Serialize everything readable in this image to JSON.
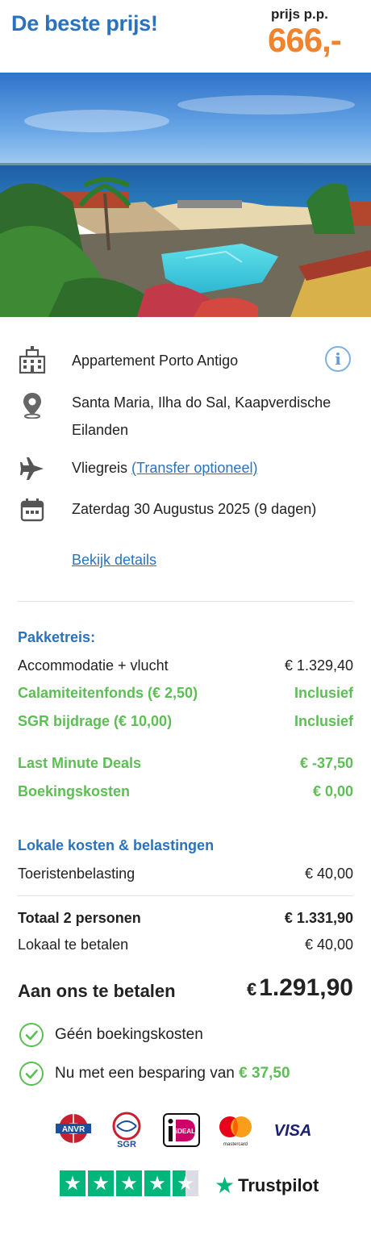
{
  "header": {
    "title": "De beste prijs!",
    "price_label": "prijs p.p.",
    "price": "666,-"
  },
  "hotel": {
    "name": "Appartement Porto Antigo",
    "location_line1": "Santa Maria, Ilha do Sal, Kaapverdische",
    "location_line2": "Eilanden",
    "travel_type": "Vliegreis",
    "transfer_link": "(Transfer optioneel)",
    "date": "Zaterdag 30 Augustus 2025 (9 dagen)",
    "details_link": "Bekijk details",
    "info_icon": "i"
  },
  "costs": {
    "package_heading": "Pakketreis:",
    "rows": [
      {
        "label": "Accommodatie + vlucht",
        "value": "€ 1.329,40"
      },
      {
        "label": "Calamiteitenfonds (€ 2,50)",
        "value": "Inclusief"
      },
      {
        "label": "SGR bijdrage (€ 10,00)",
        "value": "Inclusief"
      },
      {
        "label": "Last Minute Deals",
        "value": "€ -37,50"
      },
      {
        "label": "Boekingskosten",
        "value": "€ 0,00"
      }
    ],
    "local_heading": "Lokale kosten & belastingen",
    "tourist_tax_label": "Toeristenbelasting",
    "tourist_tax_value": "€ 40,00",
    "total_label": "Totaal 2 personen",
    "total_value": "€ 1.331,90",
    "local_pay_label": "Lokaal te betalen",
    "local_pay_value": "€ 40,00",
    "pay_label": "Aan ons te betalen",
    "pay_currency": "€",
    "pay_value": "1.291,90"
  },
  "benefits": {
    "no_booking_costs": "Géén boekingskosten",
    "savings_prefix": "Nu met een besparing van",
    "savings_amount": "€ 37,50"
  },
  "logos": {
    "anvr": "ANVR",
    "sgr": "SGR",
    "ideal": "iDEAL",
    "mastercard": "mastercard",
    "visa": "VISA"
  },
  "trustpilot": {
    "label": "Trustpilot",
    "rating": 4.5,
    "max": 5
  },
  "colors": {
    "brand_blue": "#2b72bd",
    "price_orange": "#f0832d",
    "green": "#5cbf53",
    "trustpilot_green": "#00b67a"
  }
}
